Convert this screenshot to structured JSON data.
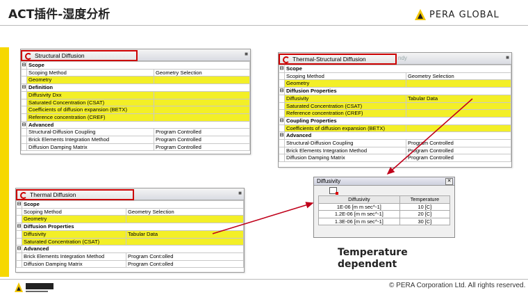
{
  "slide": {
    "title": "ACT插件-湿度分析",
    "logo_text": "PERA GLOBAL",
    "footer_copyright": "©  PERA Corporation Ltd. All rights reserved."
  },
  "structural_panel": {
    "title": "Structural Diffusion",
    "rows": [
      {
        "type": "cat",
        "label": "Scope"
      },
      {
        "type": "row",
        "label": "Scoping Method",
        "value": "Geometry Selection",
        "hl": false
      },
      {
        "type": "row",
        "label": "Geometry",
        "value": "",
        "hl": true
      },
      {
        "type": "cat",
        "label": "Definition"
      },
      {
        "type": "row",
        "label": "Diffusivity Dxx",
        "value": "",
        "hl": true
      },
      {
        "type": "row",
        "label": "Saturated Concentration (CSAT)",
        "value": "",
        "hl": true
      },
      {
        "type": "row",
        "label": "Coefficients of diffusion expansion (BETX)",
        "value": "",
        "hl": true
      },
      {
        "type": "row",
        "label": "Reference concentration (CREF)",
        "value": "",
        "hl": true
      },
      {
        "type": "cat",
        "label": "Advanced"
      },
      {
        "type": "row",
        "label": "Structural-Diffusion Coupling",
        "value": "Program Controlled",
        "hl": false
      },
      {
        "type": "row",
        "label": "Brick Elements Integration Method",
        "value": "Program Controlled",
        "hl": false
      },
      {
        "type": "row",
        "label": "Diffusion Damping Matrix",
        "value": "Program Controlled",
        "hl": false
      }
    ]
  },
  "thermal_structural_panel": {
    "title": "Thermal-Structural Diffusion",
    "faded_title": "ndy",
    "rows": [
      {
        "type": "cat",
        "label": "Scope"
      },
      {
        "type": "row",
        "label": "Scoping Method",
        "value": "Geometry Selection",
        "hl": false
      },
      {
        "type": "row",
        "label": "Geometry",
        "value": "",
        "hl": true
      },
      {
        "type": "cat",
        "label": "Diffusion Properties"
      },
      {
        "type": "row",
        "label": "Diffusivity",
        "value": "Tabular Data",
        "hl": true
      },
      {
        "type": "row",
        "label": "Saturated Concentration (CSAT)",
        "value": "",
        "hl": true
      },
      {
        "type": "row",
        "label": "Reference concentration (CREF)",
        "value": "",
        "hl": true
      },
      {
        "type": "cat",
        "label": "Coupling Properties"
      },
      {
        "type": "row",
        "label": "Coefficients of diffusion expansion (BETX)",
        "value": "",
        "hl": true
      },
      {
        "type": "cat",
        "label": "Advanced"
      },
      {
        "type": "row",
        "label": "Structural-Diffusion Coupling",
        "value": "Program Controlled",
        "hl": false
      },
      {
        "type": "row",
        "label": "Brick Elements Integration Method",
        "value": "Program Controlled",
        "hl": false
      },
      {
        "type": "row",
        "label": "Diffusion Damping Matrix",
        "value": "Program Controlled",
        "hl": false
      }
    ]
  },
  "thermal_panel": {
    "title": "Thermal Diffusion",
    "rows": [
      {
        "type": "cat",
        "label": "Scope"
      },
      {
        "type": "row",
        "label": "Scoping Method",
        "value": "Geometry Selection",
        "hl": false
      },
      {
        "type": "row",
        "label": "Geometry",
        "value": "",
        "hl": true
      },
      {
        "type": "cat",
        "label": "Diffusion Properties"
      },
      {
        "type": "row",
        "label": "Diffusivity",
        "value": "Tabular Data",
        "hl": true
      },
      {
        "type": "row",
        "label": "Saturated Concentration (CSAT)",
        "value": "",
        "hl": true
      },
      {
        "type": "cat",
        "label": "Advanced"
      },
      {
        "type": "row",
        "label": "Brick Elements Integration Method",
        "value": "Program Cont:olled",
        "hl": false
      },
      {
        "type": "row",
        "label": "Diffusion Damping Matrix",
        "value": "Program Cont:olled",
        "hl": false
      }
    ]
  },
  "diffusivity_window": {
    "title": "Diffusivity",
    "close_glyph": "✕",
    "headers": [
      "Diffusivity",
      "Temperature"
    ],
    "rows": [
      [
        "1E-06 [m m sec^-1]",
        "10 [C]"
      ],
      [
        "1.2E-06 [m m sec^-1]",
        "20 [C]"
      ],
      [
        "1.3E-06 [m m sec^-1]",
        "30 [C]"
      ]
    ]
  },
  "caption": {
    "line1": "Temperature",
    "line2": "dependent"
  },
  "colors": {
    "highlight": "#f3ef27",
    "accent_red": "#cc0000",
    "arrow": "#c0001a",
    "side_bar": "#f6d800"
  }
}
